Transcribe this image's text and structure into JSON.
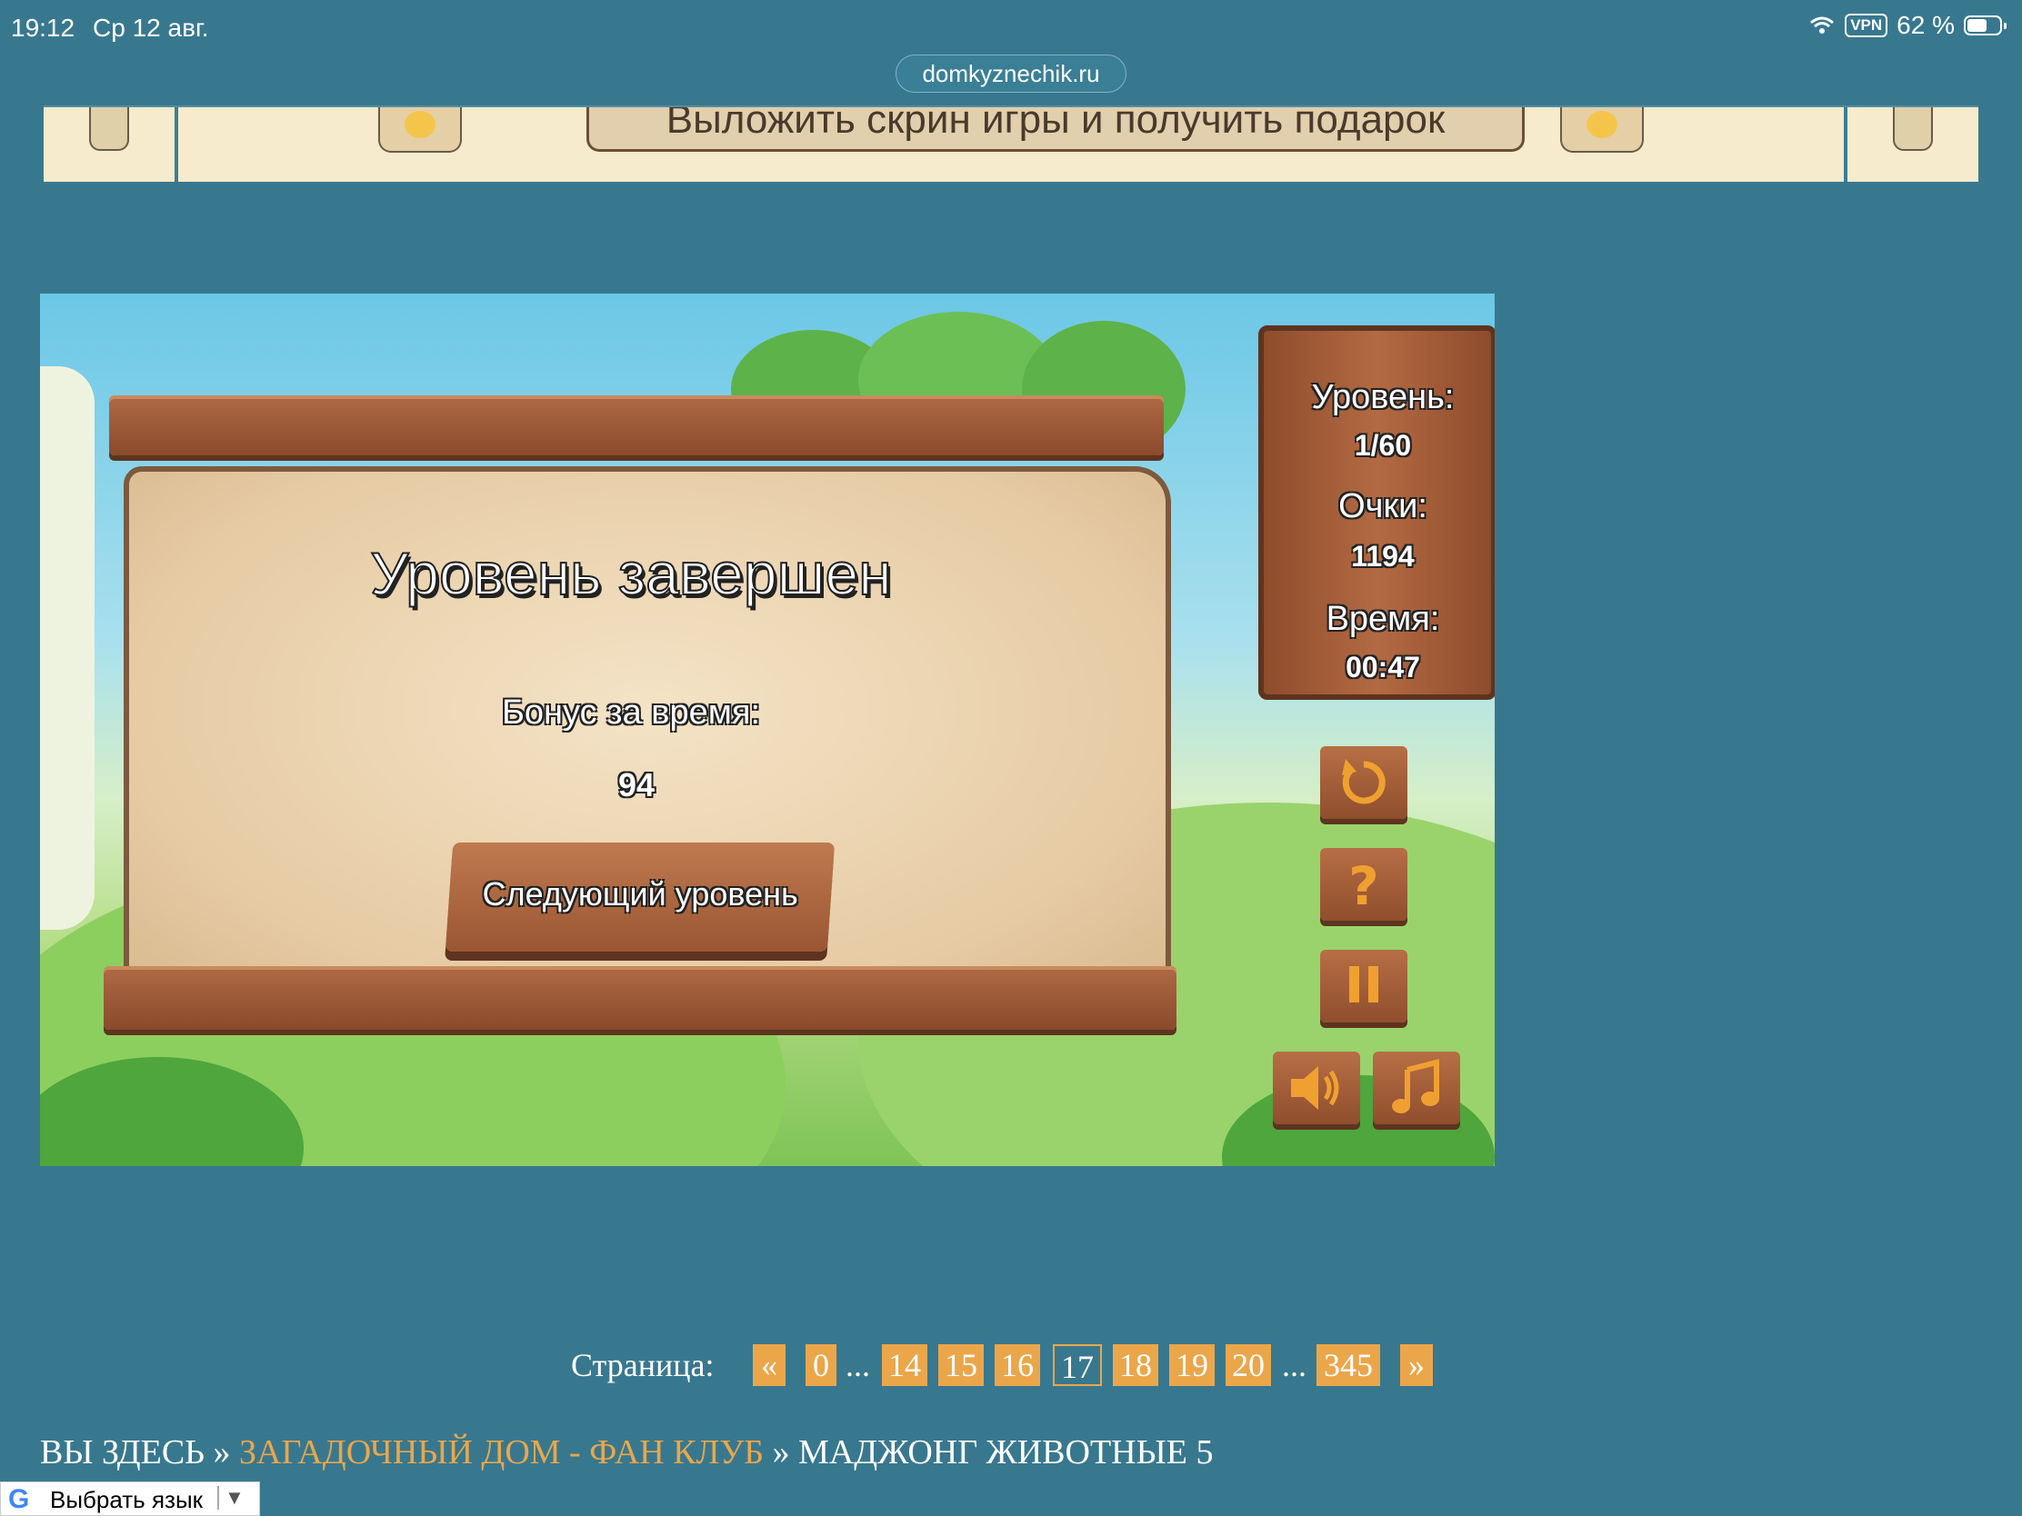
{
  "statusbar": {
    "time": "19:12",
    "date": "Ср 12 авг.",
    "vpn": "VPN",
    "battery": "62 %",
    "battery_level": 0.62
  },
  "browser": {
    "url": "domkyznechik.ru"
  },
  "banner": {
    "promo_text": "Выложить скрин игры и получить подарок"
  },
  "game": {
    "title": "Уровень завершен",
    "bonus_label": "Бонус за время:",
    "bonus_value": "94",
    "next_button": "Следующий уровень",
    "level_label": "Уровень:",
    "level_value": "1/60",
    "score_label": "Очки:",
    "score_value": "1194",
    "time_label": "Время:",
    "time_value": "00:47",
    "controls": [
      "restart-icon",
      "help-icon",
      "pause-icon",
      "sound-icon",
      "music-icon"
    ]
  },
  "pager": {
    "label": "Страница:",
    "prev": "«",
    "next": "»",
    "dots": "...",
    "pages": [
      "0",
      "14",
      "15",
      "16",
      "17",
      "18",
      "19",
      "20",
      "345"
    ],
    "current": "17"
  },
  "breadcrumb": {
    "here": "ВЫ ЗДЕСЬ",
    "sep": "»",
    "link": "ЗАГАДОЧНЫЙ ДОМ - ФАН КЛУБ",
    "current": "МАДЖОНГ ЖИВОТНЫЕ 5"
  },
  "translate": {
    "g": "G",
    "label": "Выбрать язык",
    "arrow": "▼"
  },
  "colors": {
    "page_bg": "#38788f",
    "accent": "#eba64a",
    "wood": "#a35f3a",
    "parchment": "#efdcbc"
  }
}
